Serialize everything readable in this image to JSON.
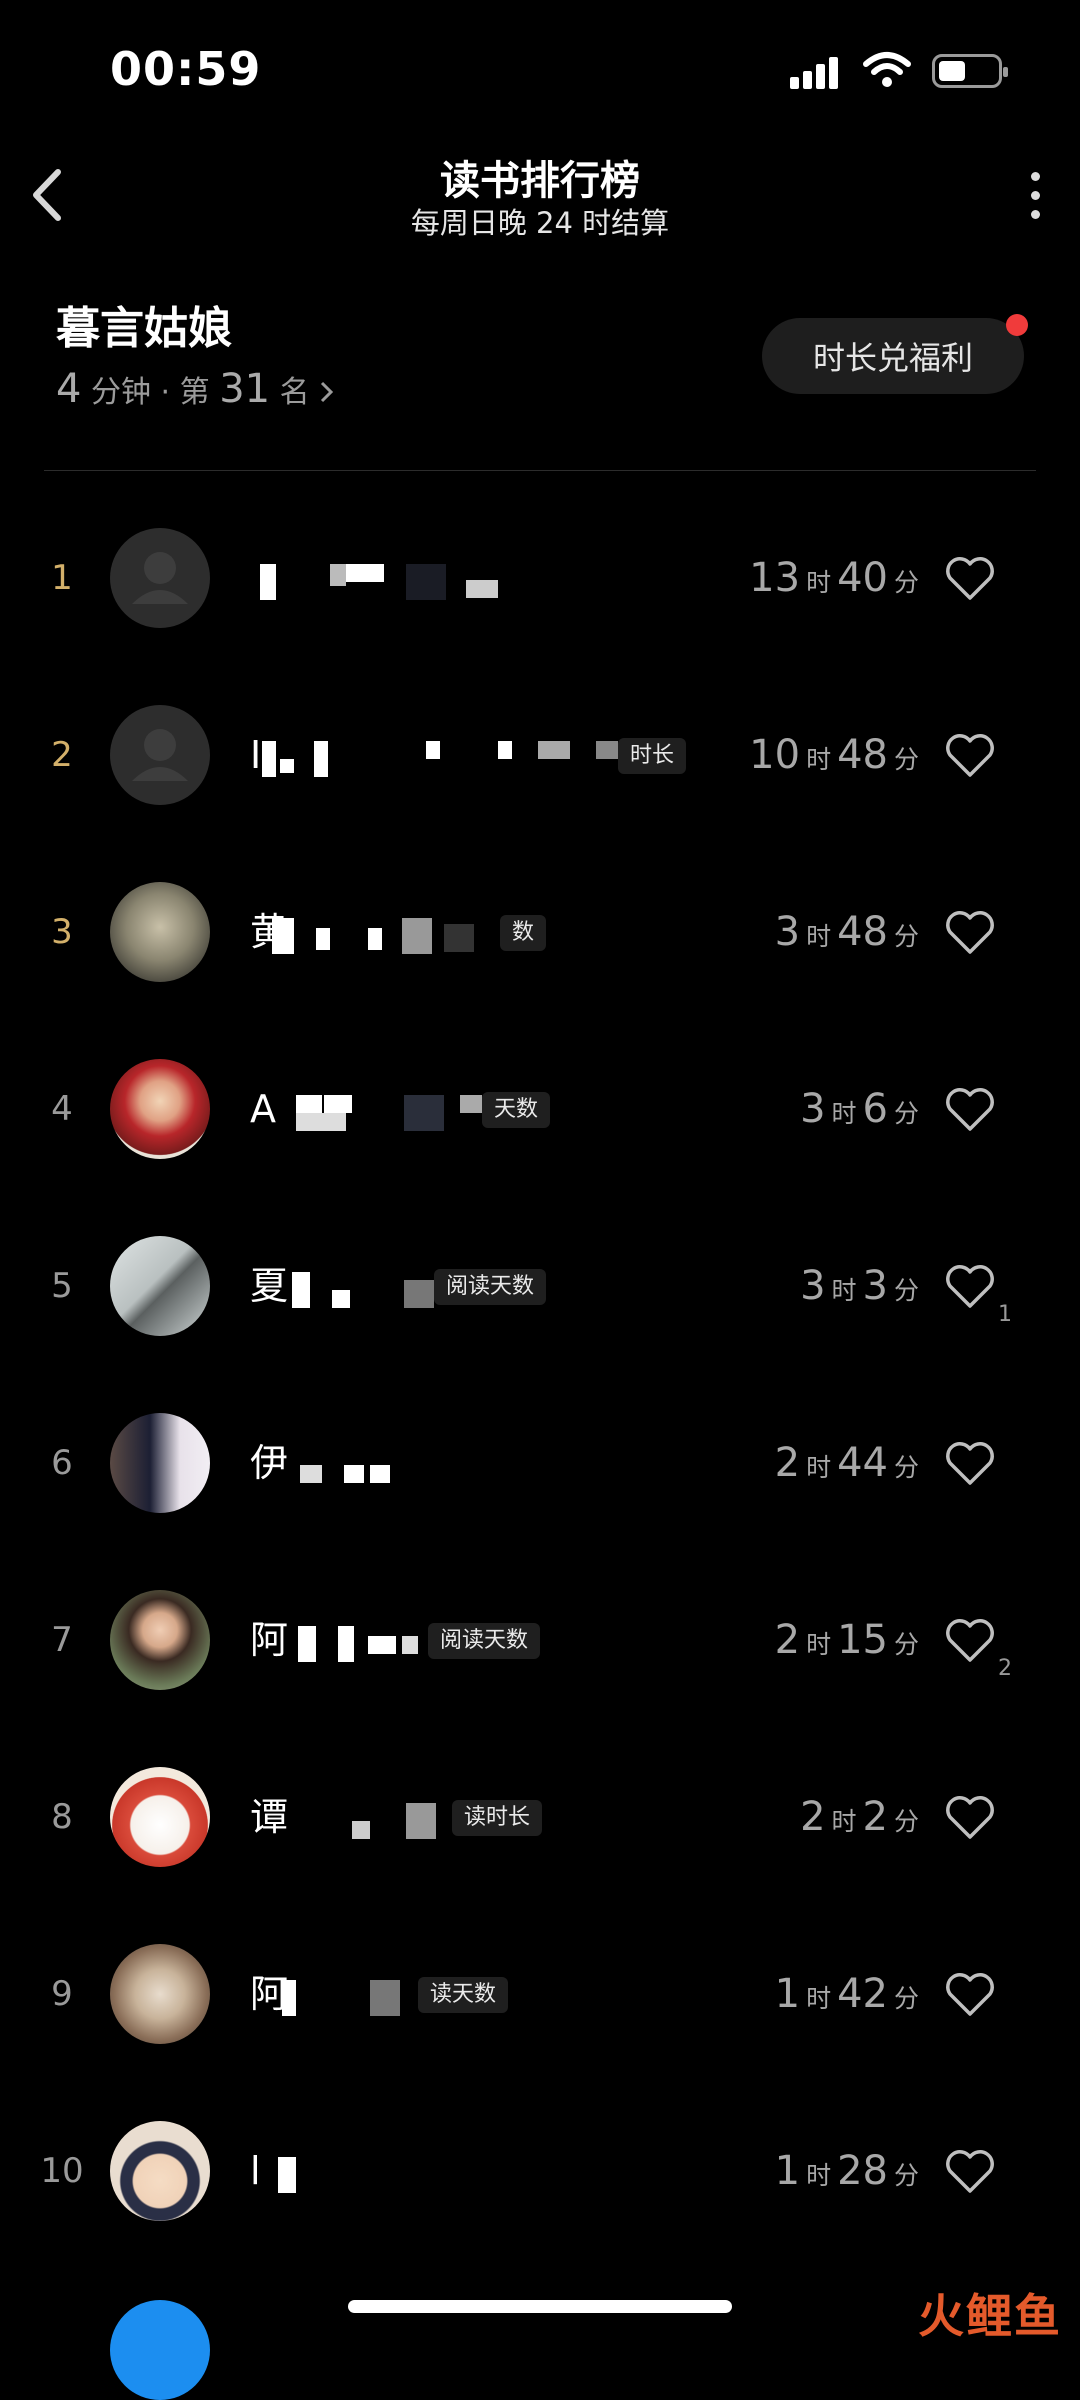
{
  "status_bar": {
    "time": "00:59"
  },
  "header": {
    "title": "读书排行榜",
    "subtitle": "每周日晚 24 时结算"
  },
  "me": {
    "name": "暮言姑娘",
    "minutes": "4",
    "minutes_unit": "分钟",
    "separator": "·",
    "rank_prefix": "第",
    "rank": "31",
    "rank_suffix": "名",
    "welfare_button": "时长兑福利"
  },
  "units": {
    "hour": "时",
    "minute": "分"
  },
  "entries": [
    {
      "rank": "1",
      "name_visible": "",
      "tag": "",
      "hours": "13",
      "minutes": "40",
      "likes": ""
    },
    {
      "rank": "2",
      "name_visible": "I",
      "tag": "时长",
      "hours": "10",
      "minutes": "48",
      "likes": ""
    },
    {
      "rank": "3",
      "name_visible": "黄",
      "tag": "数",
      "hours": "3",
      "minutes": "48",
      "likes": ""
    },
    {
      "rank": "4",
      "name_visible": "A",
      "tag": "天数",
      "hours": "3",
      "minutes": "6",
      "likes": ""
    },
    {
      "rank": "5",
      "name_visible": "夏",
      "tag": "阅读天数",
      "hours": "3",
      "minutes": "3",
      "likes": "1"
    },
    {
      "rank": "6",
      "name_visible": "伊",
      "tag": "",
      "hours": "2",
      "minutes": "44",
      "likes": ""
    },
    {
      "rank": "7",
      "name_visible": "阿",
      "tag": "阅读天数",
      "hours": "2",
      "minutes": "15",
      "likes": "2"
    },
    {
      "rank": "8",
      "name_visible": "谭",
      "tag": "读时长",
      "hours": "2",
      "minutes": "2",
      "likes": ""
    },
    {
      "rank": "9",
      "name_visible": "阿",
      "tag": "读天数",
      "hours": "1",
      "minutes": "42",
      "likes": ""
    },
    {
      "rank": "10",
      "name_visible": "l",
      "tag": "",
      "hours": "1",
      "minutes": "28",
      "likes": ""
    }
  ],
  "watermark": "火鲤鱼",
  "colors": {
    "background": "#000000",
    "top_rank": "#d3b06a",
    "badge_dot": "#f03b3b"
  }
}
